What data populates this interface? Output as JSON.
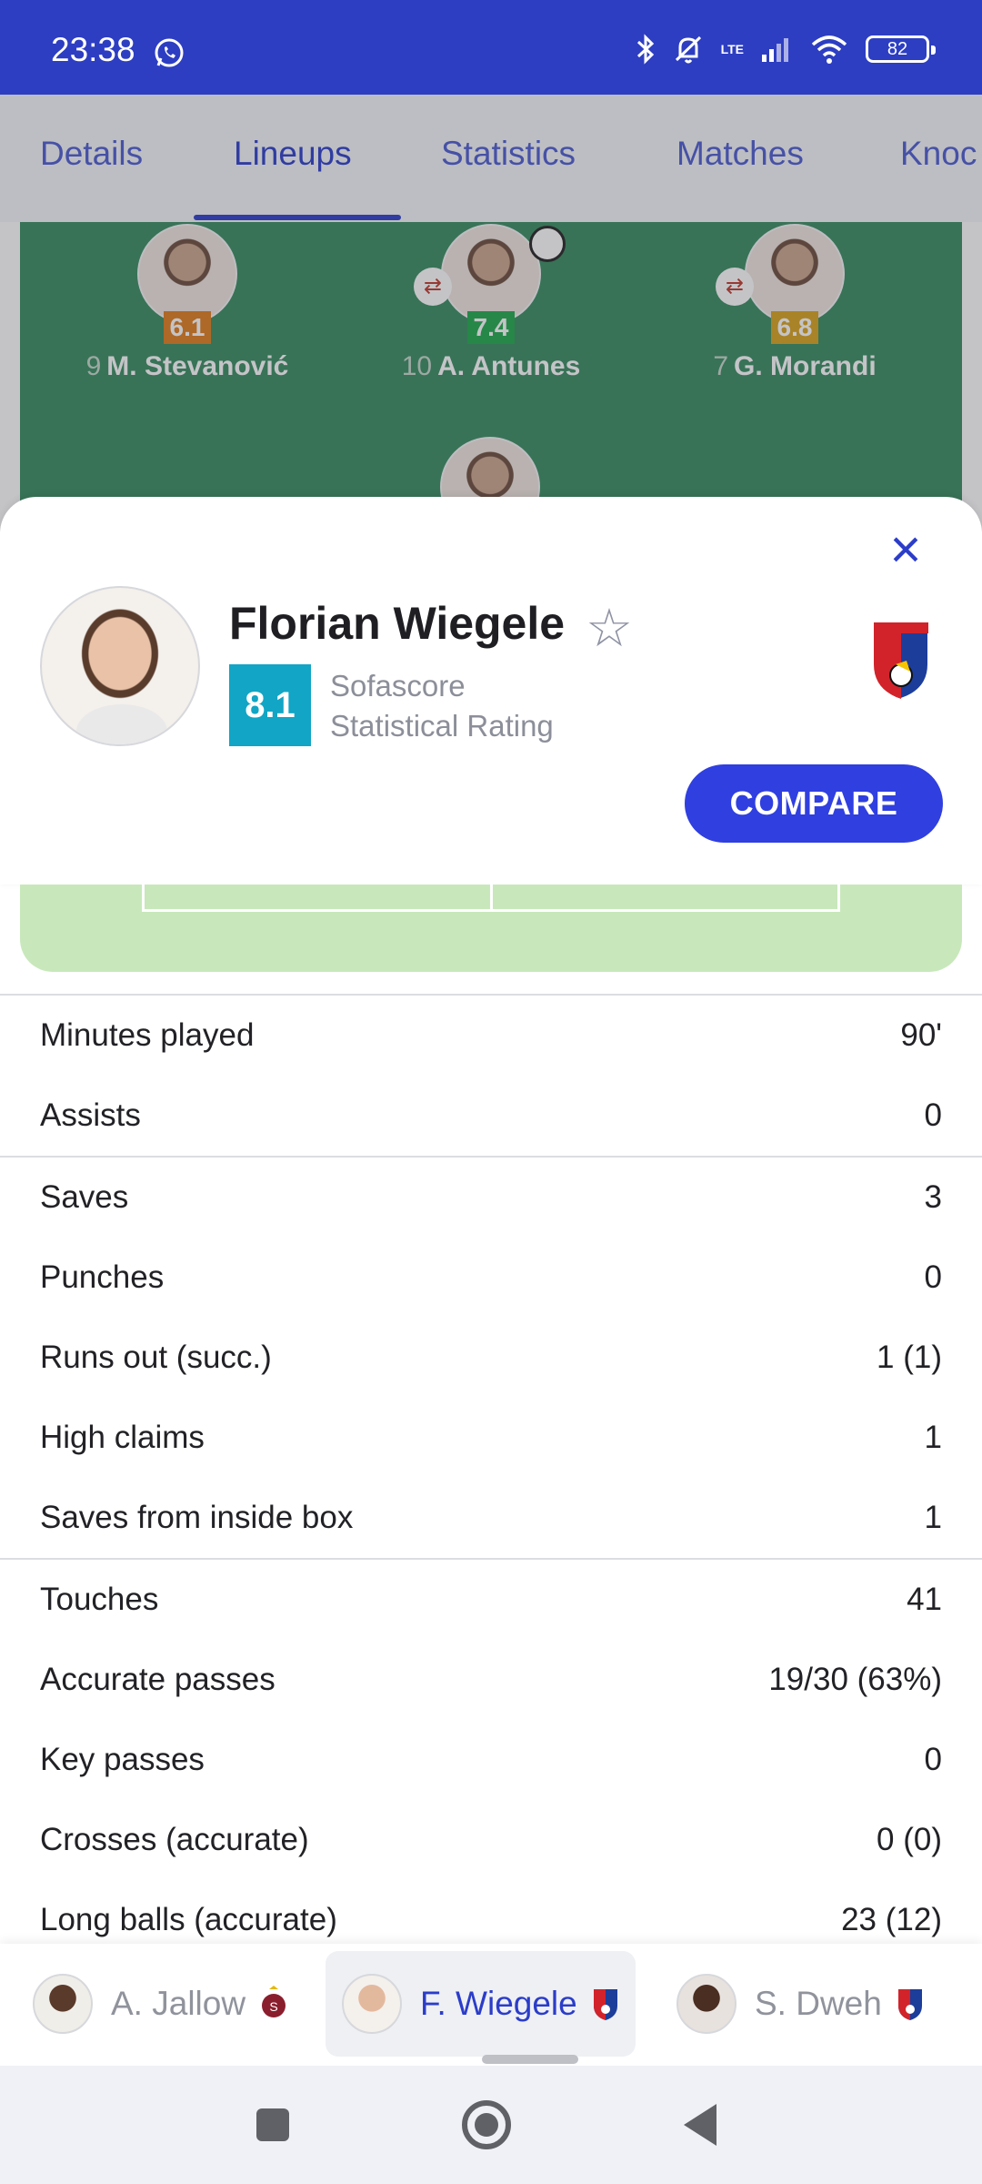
{
  "status_bar": {
    "time": "23:38",
    "network": "LTE",
    "battery": "82",
    "icons": [
      "whatsapp-icon",
      "bluetooth-icon",
      "bell-off-icon",
      "signal-icon",
      "wifi-icon",
      "battery-icon"
    ]
  },
  "tabs": [
    {
      "label": "Details"
    },
    {
      "label": "Lineups",
      "active": true
    },
    {
      "label": "Statistics"
    },
    {
      "label": "Matches"
    },
    {
      "label": "Knoc"
    }
  ],
  "pitch_players": [
    {
      "number": "9",
      "name": "M. Stevanović",
      "rating": "6.1",
      "rating_color": "#e07b1a"
    },
    {
      "number": "10",
      "name": "A. Antunes",
      "rating": "7.4",
      "rating_color": "#1fa84a"
    },
    {
      "number": "7",
      "name": "G. Morandi",
      "rating": "6.8",
      "rating_color": "#d9a21b"
    }
  ],
  "player_card": {
    "name": "Florian Wiegele",
    "rating": "8.1",
    "rating_color": "#12a5c5",
    "rating_label_line1": "Sofascore",
    "rating_label_line2": "Statistical Rating",
    "compare_label": "COMPARE",
    "club_badge": "PLZEŇ FC VIKTORIA"
  },
  "stats_groups": [
    [
      {
        "label": "Minutes played",
        "value": "90'"
      },
      {
        "label": "Assists",
        "value": "0"
      }
    ],
    [
      {
        "label": "Saves",
        "value": "3"
      },
      {
        "label": "Punches",
        "value": "0"
      },
      {
        "label": "Runs out (succ.)",
        "value": "1 (1)"
      },
      {
        "label": "High claims",
        "value": "1"
      },
      {
        "label": "Saves from inside box",
        "value": "1"
      }
    ],
    [
      {
        "label": "Touches",
        "value": "41"
      },
      {
        "label": "Accurate passes",
        "value": "19/30 (63%)"
      },
      {
        "label": "Key passes",
        "value": "0"
      },
      {
        "label": "Crosses (accurate)",
        "value": "0 (0)"
      },
      {
        "label": "Long balls (accurate)",
        "value": "23 (12)"
      }
    ]
  ],
  "player_selector": [
    {
      "name": "A. Jallow",
      "active": false
    },
    {
      "name": "F. Wiegele",
      "active": true
    },
    {
      "name": "S. Dweh",
      "active": false
    }
  ],
  "navbar": [
    "recents-button",
    "home-button",
    "back-button"
  ]
}
